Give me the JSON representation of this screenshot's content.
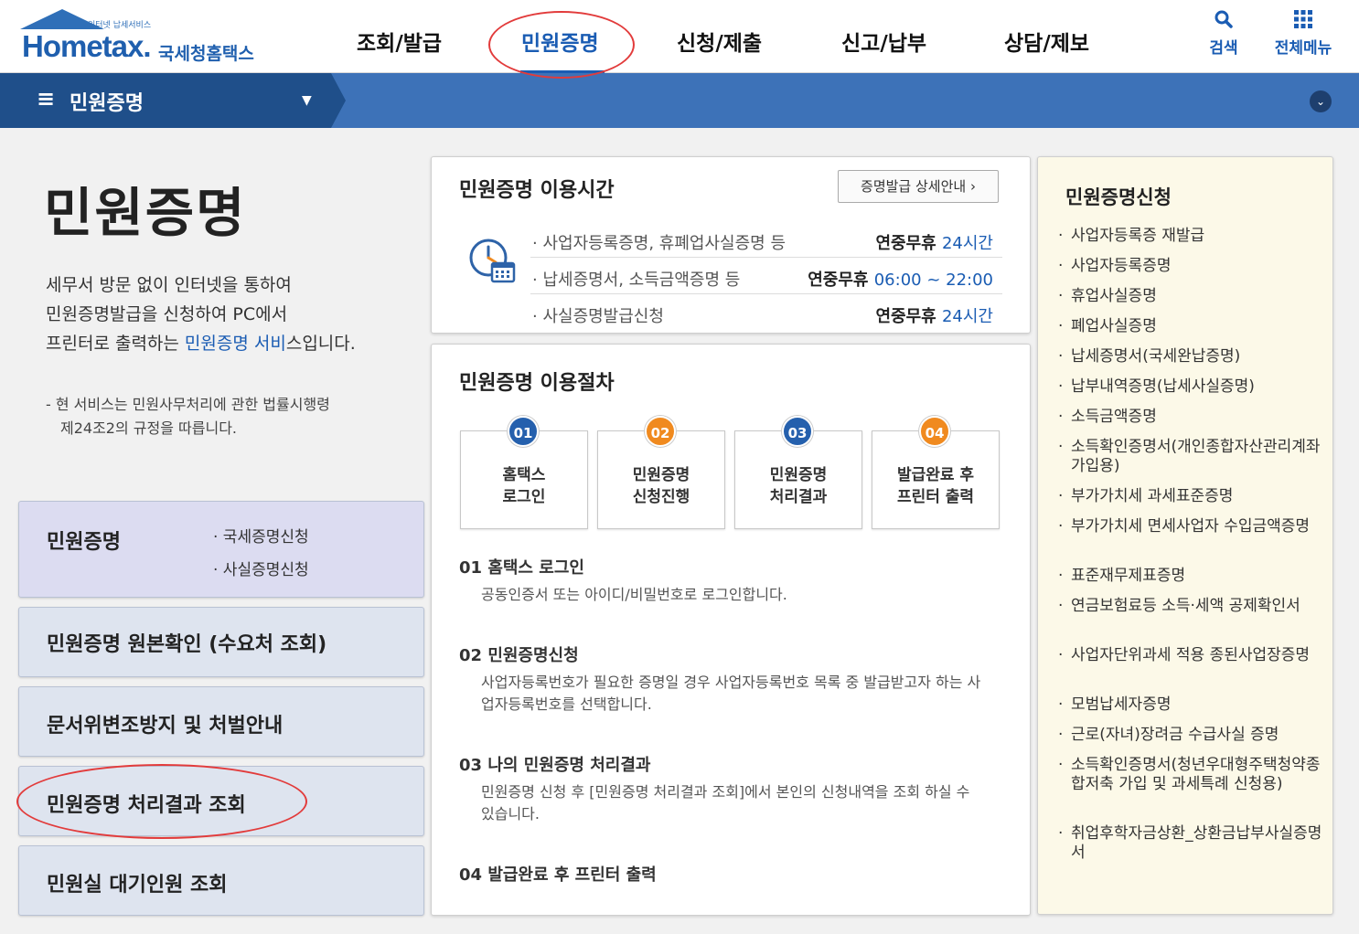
{
  "header": {
    "logo_sub": "인터넷 납세서비스",
    "logo_main": "Hometax.",
    "logo_kr": "국세청홈택스",
    "nav": [
      "조회/발급",
      "민원증명",
      "신청/제출",
      "신고/납부",
      "상담/제보"
    ],
    "active_nav": "민원증명",
    "search_label": "검색",
    "menu_label": "전체메뉴"
  },
  "subbar": {
    "title": "민원증명",
    "menu_glyph": "≡",
    "caret": "▼",
    "down_glyph": "⌄"
  },
  "left": {
    "title": "민원증명",
    "desc_line1": "세무서 방문 없이 인터넷을 통하여",
    "desc_line2": "민원증명발급을 신청하여 PC에서",
    "desc_line3_pre": "프린터로 출력하는 ",
    "desc_line3_hl": "민원증명 서비",
    "desc_line3_post": "스입니다.",
    "note_line1": "- 현 서비스는 민원사무처리에 관한 법률시행령",
    "note_line2": "제24조2의 규정을 따릅니다.",
    "boxes": {
      "b1_title": "민원증명",
      "b1_sub1": "· 국세증명신청",
      "b1_sub2": "· 사실증명신청",
      "b2_title": "민원증명 원본확인 (수요처 조회)",
      "b3_title": "문서위변조방지 및 처벌안내",
      "b4_title": "민원증명 처리결과 조회",
      "b5_title": "민원실 대기인원 조회"
    }
  },
  "hours": {
    "title": "민원증명 이용시간",
    "button": "증명발급 상세안내 ›",
    "rows": [
      {
        "label": "· 사업자등록증명, 휴폐업사실증명 등",
        "value_pre": "연중무휴 ",
        "value_b": "24시간"
      },
      {
        "label": "· 납세증명서, 소득금액증명 등",
        "value_pre": "연중무휴 ",
        "value_b": "06:00 ~ 22:00"
      },
      {
        "label": "· 사실증명발급신청",
        "value_pre": "연중무휴 ",
        "value_b": "24시간"
      }
    ]
  },
  "procedure": {
    "title": "민원증명 이용절차",
    "steps": [
      {
        "num": "01",
        "line1": "홈택스",
        "line2": "로그인",
        "color": "#2560ad"
      },
      {
        "num": "02",
        "line1": "민원증명",
        "line2": "신청진행",
        "color": "#f08a1f"
      },
      {
        "num": "03",
        "line1": "민원증명",
        "line2": "처리결과",
        "color": "#2560ad"
      },
      {
        "num": "04",
        "line1": "발급완료 후",
        "line2": "프린터 출력",
        "color": "#f08a1f"
      }
    ],
    "details": [
      {
        "head": "01 홈택스 로그인",
        "text": "공동인증서 또는 아이디/비밀번호로 로그인합니다."
      },
      {
        "head": "02 민원증명신청",
        "text": "사업자등록번호가 필요한 증명일 경우 사업자등록번호 목록 중 발급받고자 하는 사업자등록번호를 선택합니다."
      },
      {
        "head": "03 나의 민원증명 처리결과",
        "text": "민원증명 신청 후 [민원증명 처리결과 조회]에서 본인의 신청내역을 조회 하실 수 있습니다."
      },
      {
        "head": "04 발급완료 후 프린터 출력",
        "text": ""
      }
    ]
  },
  "right": {
    "title": "민원증명신청",
    "items": [
      "사업자등록증 재발급",
      "사업자등록증명",
      "휴업사실증명",
      "폐업사실증명",
      "납세증명서(국세완납증명)",
      "납부내역증명(납세사실증명)",
      "소득금액증명",
      "소득확인증명서(개인종합자산관리계좌 가입용)",
      "부가가치세 과세표준증명",
      "부가가치세 면세사업자 수입금액증명",
      "표준재무제표증명",
      "연금보험료등 소득·세액 공제확인서",
      "사업자단위과세 적용 종된사업장증명",
      "모범납세자증명",
      "근로(자녀)장려금 수급사실 증명",
      "소득확인증명서(청년우대형주택청약종합저축 가입 및 과세특례 신청용)",
      "취업후학자금상환_상환금납부사실증명서"
    ]
  },
  "colors": {
    "brand": "#1a5cb3",
    "subbar": "#3d72b8",
    "highlight_oval": "#e23b3b"
  }
}
